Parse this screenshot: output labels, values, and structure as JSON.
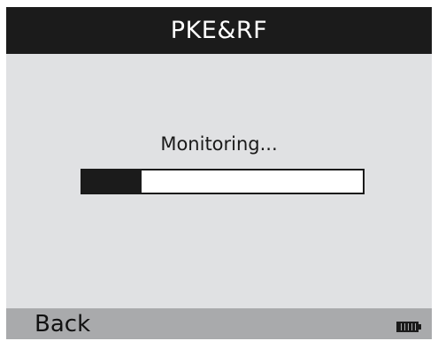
{
  "header": {
    "title": "PKE&RF"
  },
  "main": {
    "status_text": "Monitoring...",
    "progress": {
      "value_percent": 21
    }
  },
  "footer": {
    "back_label": "Back",
    "battery_icon": "battery-full-icon"
  },
  "colors": {
    "header_bg": "#1b1b1b",
    "screen_bg": "#e0e1e3",
    "footer_bg": "#a9aaac",
    "progress_fill": "#1b1b1b"
  }
}
